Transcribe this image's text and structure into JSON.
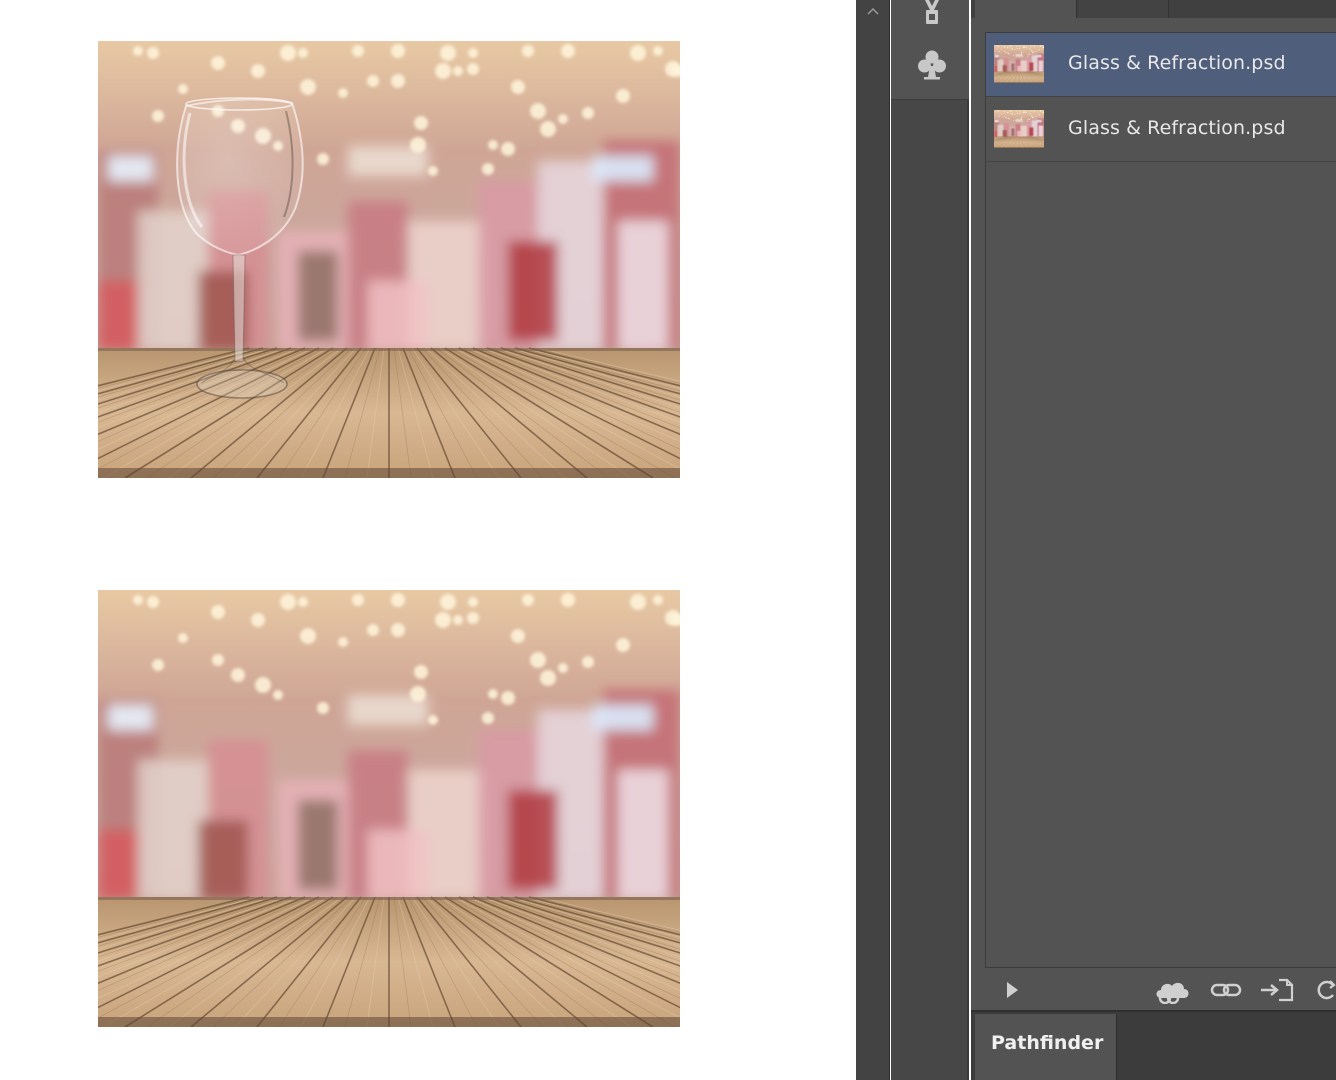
{
  "app": {
    "panel": {
      "files": [
        {
          "name": "Glass & Refraction.psd",
          "selected": true
        },
        {
          "name": "Glass & Refraction.psd",
          "selected": false
        }
      ],
      "footer_icons": [
        "play-icon",
        "creative-cloud-icon",
        "link-icon",
        "place-linked-icon",
        "update-icon"
      ]
    },
    "bottom_panel": {
      "tab_label": "Pathfinder"
    },
    "toolstrip_icons": [
      "brush-icon",
      "club-icon"
    ],
    "colors": {
      "panel_bg": "#535353",
      "selection": "#4e5e7b",
      "dark": "#434343"
    }
  },
  "canvas": {
    "images": [
      {
        "name": "bokeh-background-with-wine-glass",
        "has_glass": true
      },
      {
        "name": "bokeh-background-without-glass",
        "has_glass": false
      }
    ]
  }
}
